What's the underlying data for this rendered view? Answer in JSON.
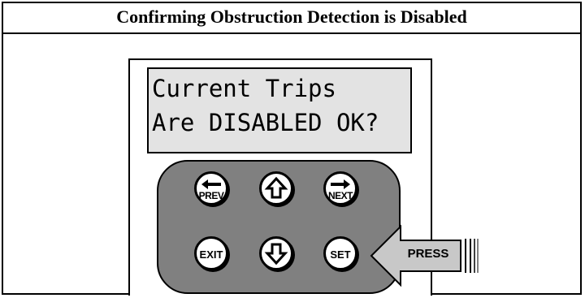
{
  "title": "Confirming Obstruction Detection is Disabled",
  "display": {
    "line1": "Current Trips",
    "line2": "Are DISABLED OK?"
  },
  "keypad": {
    "prev": "PREV",
    "next": "NEXT",
    "exit": "EXIT",
    "set": "SET"
  },
  "callout": {
    "label": "PRESS",
    "target": "SET"
  },
  "icons": {
    "prev": "left-arrow-icon",
    "up": "up-arrow-icon",
    "next": "right-arrow-icon",
    "down": "down-arrow-icon"
  },
  "colors": {
    "display_bg": "#e3e3e3",
    "keypad_bg": "#808080",
    "callout_fill": "#c8c8c8"
  }
}
